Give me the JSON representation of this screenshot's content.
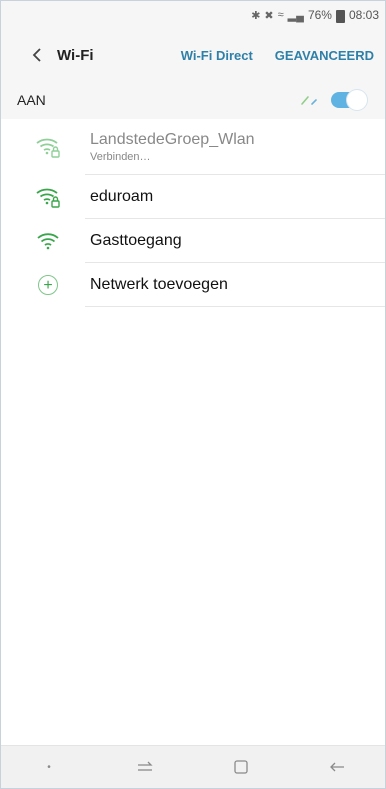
{
  "status_bar": {
    "signal_text": ".❘",
    "battery": "76%",
    "time": "08:03"
  },
  "header": {
    "title": "Wi-Fi",
    "actions": [
      "Wi-Fi Direct",
      "GEAVANCEERD"
    ]
  },
  "master": {
    "label": "AAN",
    "enabled": true
  },
  "networks": [
    {
      "name": "LandstedeGroep_Wlan",
      "status": "Verbinden…",
      "secured": true,
      "icon": "wifi-lock-icon"
    },
    {
      "name": "eduroam",
      "secured": true,
      "icon": "wifi-lock-icon"
    },
    {
      "name": "Gasttoegang",
      "secured": false,
      "icon": "wifi-icon"
    }
  ],
  "add_network": {
    "label": "Netwerk toevoegen",
    "icon": "plus-circle-icon"
  },
  "nav_bar": {
    "buttons": [
      "dot-icon",
      "recents-icon",
      "home-icon",
      "back-icon"
    ]
  },
  "colors": {
    "accent": "#2f80a8",
    "toggle": "#5fb3e3",
    "wifi_icon": "#3aa64b",
    "background": "#f6f6f6"
  }
}
